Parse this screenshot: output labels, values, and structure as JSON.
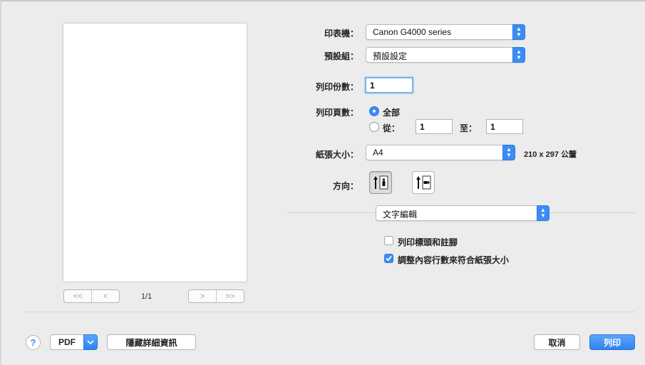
{
  "preview": {
    "page_indicator": "1/1",
    "nav": {
      "first": "<<",
      "prev": "<",
      "next": ">",
      "last": ">>"
    }
  },
  "form": {
    "printer": {
      "label": "印表機：",
      "value": "Canon G4000 series"
    },
    "preset": {
      "label": "預設組：",
      "value": "預設設定"
    },
    "copies": {
      "label": "列印份數：",
      "value": "1"
    },
    "pages": {
      "label": "列印頁數：",
      "all_label": "全部",
      "from_label": "從：",
      "from_value": "1",
      "to_label": "至：",
      "to_value": "1",
      "selected": "all"
    },
    "paper_size": {
      "label": "紙張大小：",
      "value": "A4",
      "dimensions": "210 x 297 公釐"
    },
    "orientation": {
      "label": "方向：",
      "selected": "portrait"
    },
    "section_popup": "文字編輯",
    "options": [
      {
        "label": "列印標頭和註腳",
        "checked": false
      },
      {
        "label": "調整內容行數來符合紙張大小",
        "checked": true
      }
    ]
  },
  "footer": {
    "help": "?",
    "pdf_label": "PDF",
    "hide_details": "隱藏詳細資訊",
    "cancel": "取消",
    "print": "列印"
  },
  "colors": {
    "accent": "#3b8cf5",
    "background": "#ececec"
  }
}
